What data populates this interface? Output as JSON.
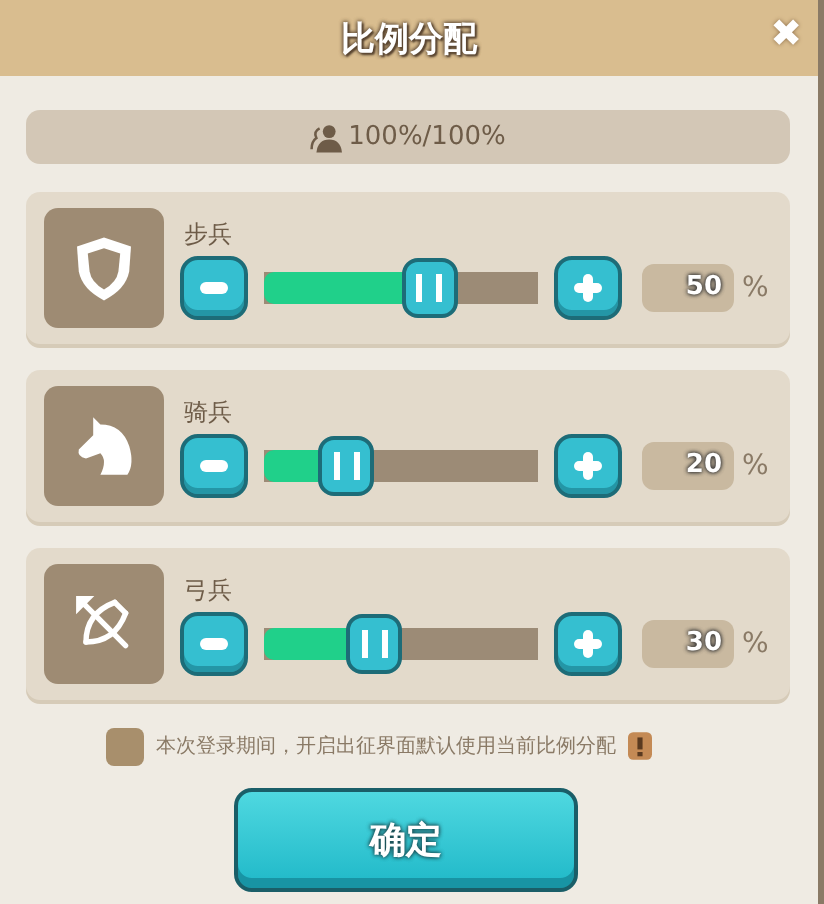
{
  "window": {
    "title": "比例分配",
    "close": "✖"
  },
  "summary": {
    "text": "100%/100%"
  },
  "troops": [
    {
      "kind": "shield",
      "name": "步兵",
      "level": 0.5,
      "value": "50",
      "unit": "%"
    },
    {
      "kind": "horse",
      "name": "骑兵",
      "level": 0.2,
      "value": "20",
      "unit": "%"
    },
    {
      "kind": "bow",
      "name": "弓兵",
      "level": 0.3,
      "value": "30",
      "unit": "%"
    }
  ],
  "option": {
    "label": "本次登录期间，开启出征界面默认使用当前比例分配",
    "checked": false
  },
  "confirm": "确定"
}
